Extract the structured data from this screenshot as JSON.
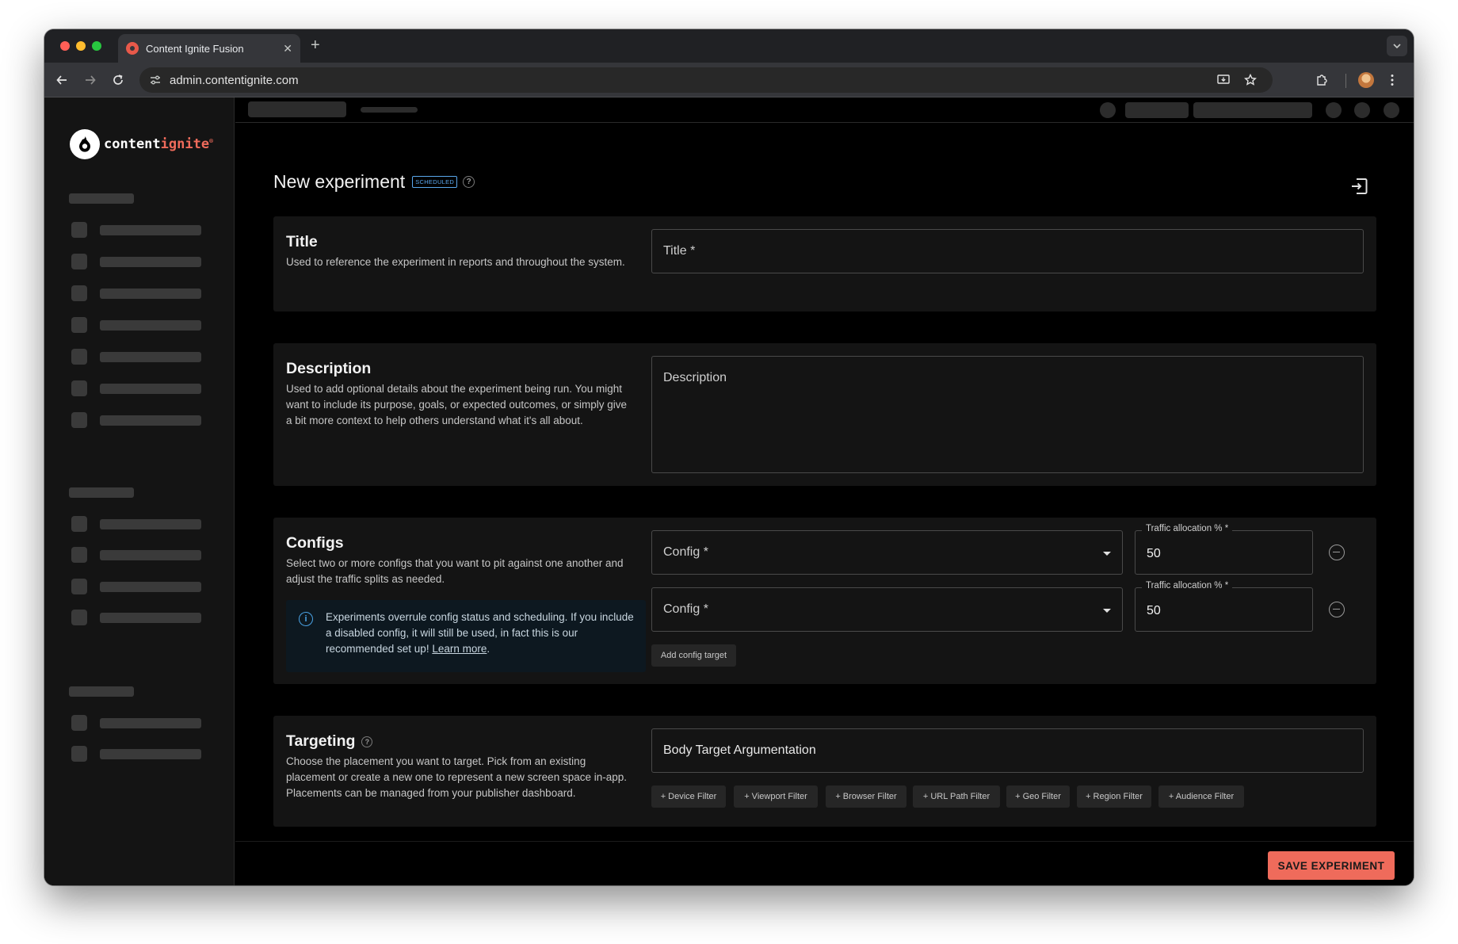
{
  "browser": {
    "tab_title": "Content Ignite Fusion",
    "tab_close": "✕",
    "new_tab": "+",
    "url": "admin.contentignite.com"
  },
  "sidebar": {
    "logo_text_main": "content",
    "logo_text_accent": "ignite",
    "logo_mark": "®"
  },
  "page": {
    "title": "New experiment",
    "status_badge": "SCHEDULED",
    "help": "?"
  },
  "sections": {
    "title": {
      "heading": "Title",
      "description": "Used to reference the experiment in reports and throughout the system.",
      "input_placeholder": "Title *"
    },
    "description": {
      "heading": "Description",
      "description": "Used to add optional details about the experiment being run. You might want to include its purpose, goals, or expected outcomes, or simply give a bit more context to help others understand what it's all about.",
      "input_placeholder": "Description"
    },
    "configs": {
      "heading": "Configs",
      "description": "Select two or more configs that you want to pit against one another and adjust the traffic splits as needed.",
      "info_text": "Experiments overrule config status and scheduling. If you include a disabled config, it will still be used, in fact this is our recommended set up!",
      "info_link": "Learn more",
      "info_link_suffix": ".",
      "rows": [
        {
          "config_placeholder": "Config *",
          "traffic_label": "Traffic allocation % *",
          "traffic_value": "50"
        },
        {
          "config_placeholder": "Config *",
          "traffic_label": "Traffic allocation % *",
          "traffic_value": "50"
        }
      ],
      "add_button": "Add config target"
    },
    "targeting": {
      "heading": "Targeting",
      "description": "Choose the placement you want to target. Pick from an existing placement or create a new one to represent a new screen space in-app. Placements can be managed from your publisher dashboard.",
      "placement_value": "Body Target Argumentation",
      "filters": [
        "+ Device Filter",
        "+ Viewport Filter",
        "+ Browser Filter",
        "+ URL Path Filter",
        "+ Geo Filter",
        "+ Region Filter",
        "+ Audience Filter"
      ]
    }
  },
  "footer": {
    "save_label": "SAVE EXPERIMENT"
  },
  "colors": {
    "accent": "#ef6b5b",
    "badge": "#5aa7ec",
    "background": "#000000",
    "card": "#141414"
  }
}
